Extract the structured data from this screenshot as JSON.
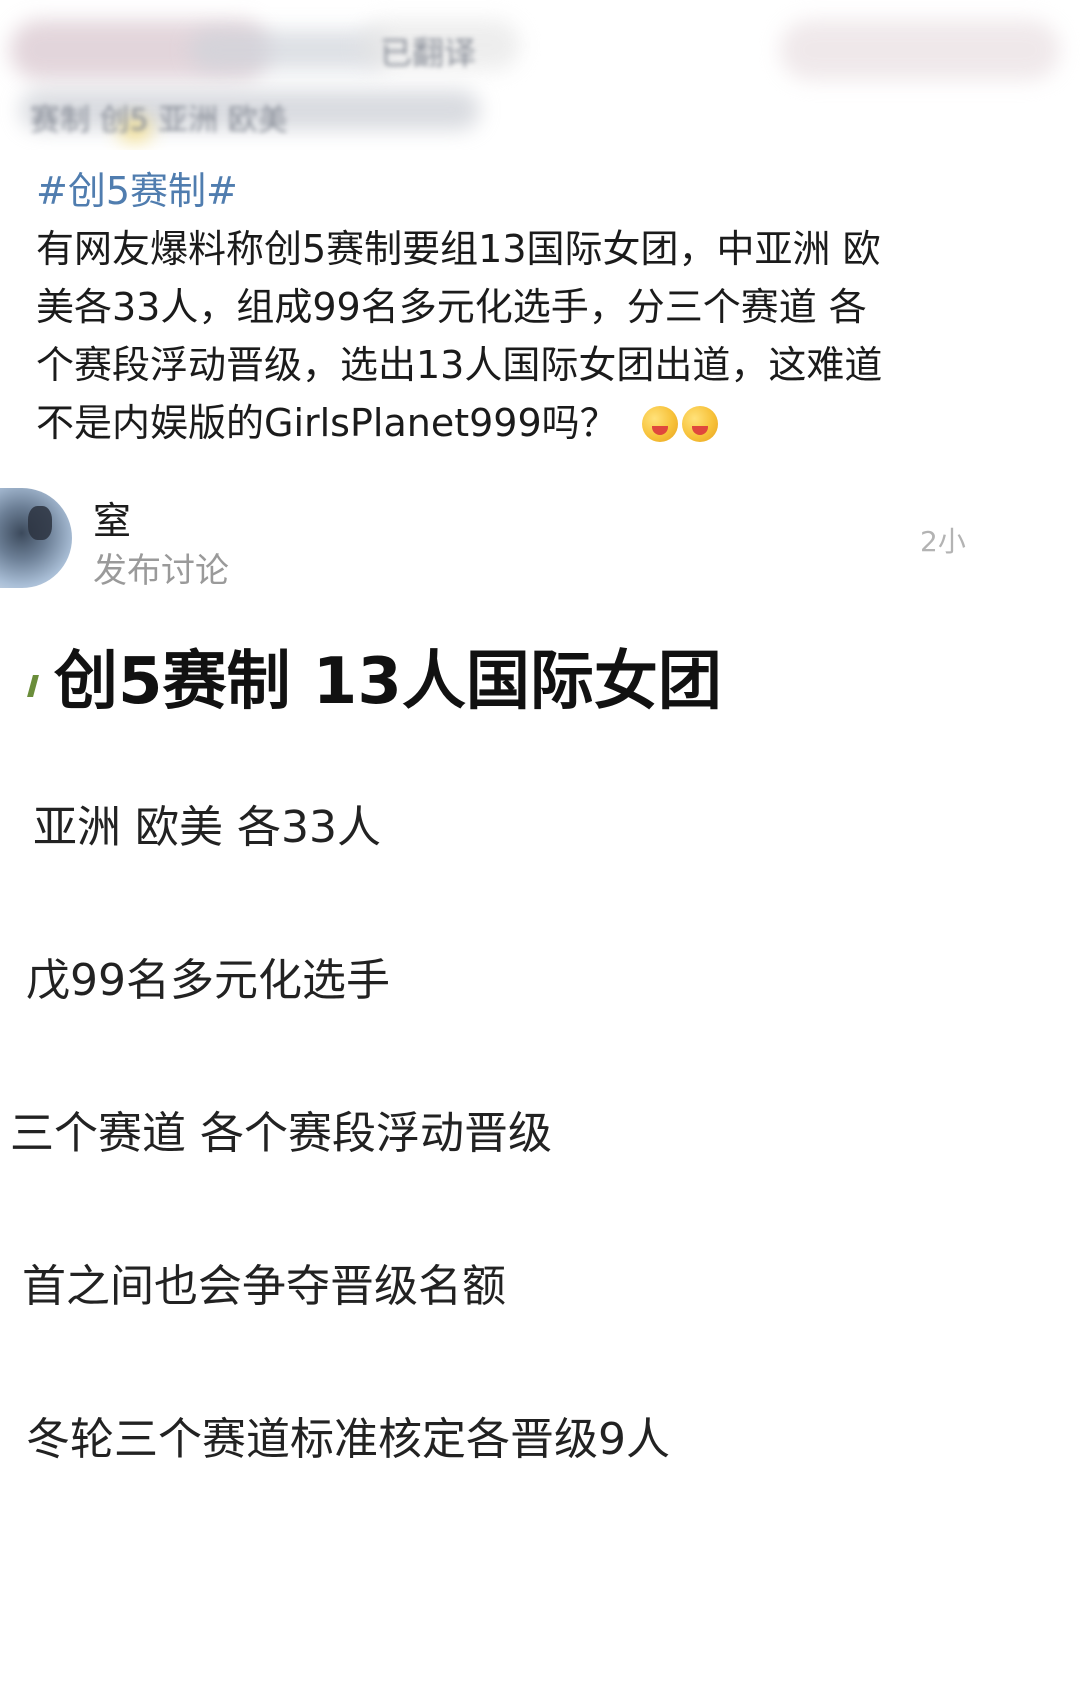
{
  "header": {
    "blurred_text_1": "已翻译",
    "blurred_text_2": "赛制 创5 亚洲 欧美"
  },
  "post": {
    "hashtag": "#创5赛制#",
    "text_lines": [
      "有网友爆料称创5赛制要组13国际女团，中亚洲 欧",
      "美各33人，组成99名多元化选手，分三个赛道 各",
      "个赛段浮动晋级，选出13人国际女团出道，这难道",
      "不是内娱版的GirlsPlanet999吗？"
    ],
    "emojis": [
      "smiling-face-emoji",
      "smiling-face-emoji"
    ]
  },
  "discussion": {
    "username": "窒",
    "action": "发布讨论",
    "timestamp": "2小",
    "title": "创5赛制 13人国际女团",
    "lines": [
      "亚洲 欧美 各33人",
      "戊99名多元化选手",
      "三个赛道 各个赛段浮动晋级",
      "首之间也会争夺晋级名额",
      "冬轮三个赛道标准核定各晋级9人"
    ]
  }
}
